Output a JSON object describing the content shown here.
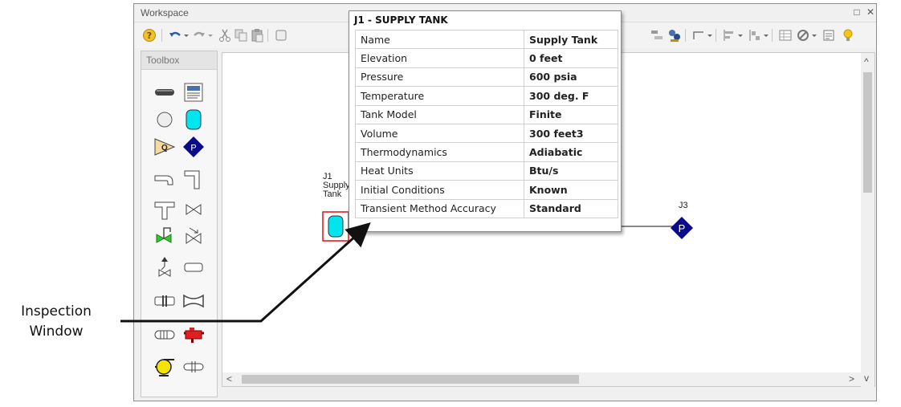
{
  "window": {
    "title": "Workspace",
    "restore_glyph": "□",
    "close_glyph": "✕"
  },
  "toolbox": {
    "title": "Toolbox",
    "tools": [
      "pipe",
      "annotation",
      "branch",
      "tank",
      "assigned-flow",
      "assigned-pressure",
      "bend",
      "elbow",
      "tee",
      "valve",
      "relief-valve",
      "check-valve",
      "surge-tank",
      "volume-balance",
      "spray-discharge",
      "area-change",
      "heat-exchanger",
      "compressor",
      "pump",
      "orifice"
    ]
  },
  "canvas": {
    "junction_j1": {
      "id": "J1",
      "name_line1": "Supply",
      "name_line2": "Tank"
    },
    "junction_j3": {
      "id": "J3",
      "glyph": "P"
    },
    "scroll": {
      "up": "^",
      "down": "v",
      "left": "<",
      "right": ">"
    }
  },
  "popup": {
    "title": "J1 - SUPPLY TANK",
    "rows": [
      {
        "key": "Name",
        "value": "Supply Tank"
      },
      {
        "key": "Elevation",
        "value": "0 feet"
      },
      {
        "key": "Pressure",
        "value": "600 psia"
      },
      {
        "key": "Temperature",
        "value": "300 deg. F"
      },
      {
        "key": "Tank Model",
        "value": "Finite"
      },
      {
        "key": "Volume",
        "value": "300 feet3"
      },
      {
        "key": "Thermodynamics",
        "value": "Adiabatic"
      },
      {
        "key": "Heat Units",
        "value": "Btu/s"
      },
      {
        "key": "Initial Conditions",
        "value": "Known"
      },
      {
        "key": "Transient Method Accuracy",
        "value": "Standard"
      }
    ]
  },
  "callout": {
    "line1": "Inspection",
    "line2": "Window"
  },
  "colors": {
    "tank": "#00e5ee",
    "pressure_junction": "#0a0a8c",
    "selection": "#e02020",
    "pipe": "#888888"
  }
}
